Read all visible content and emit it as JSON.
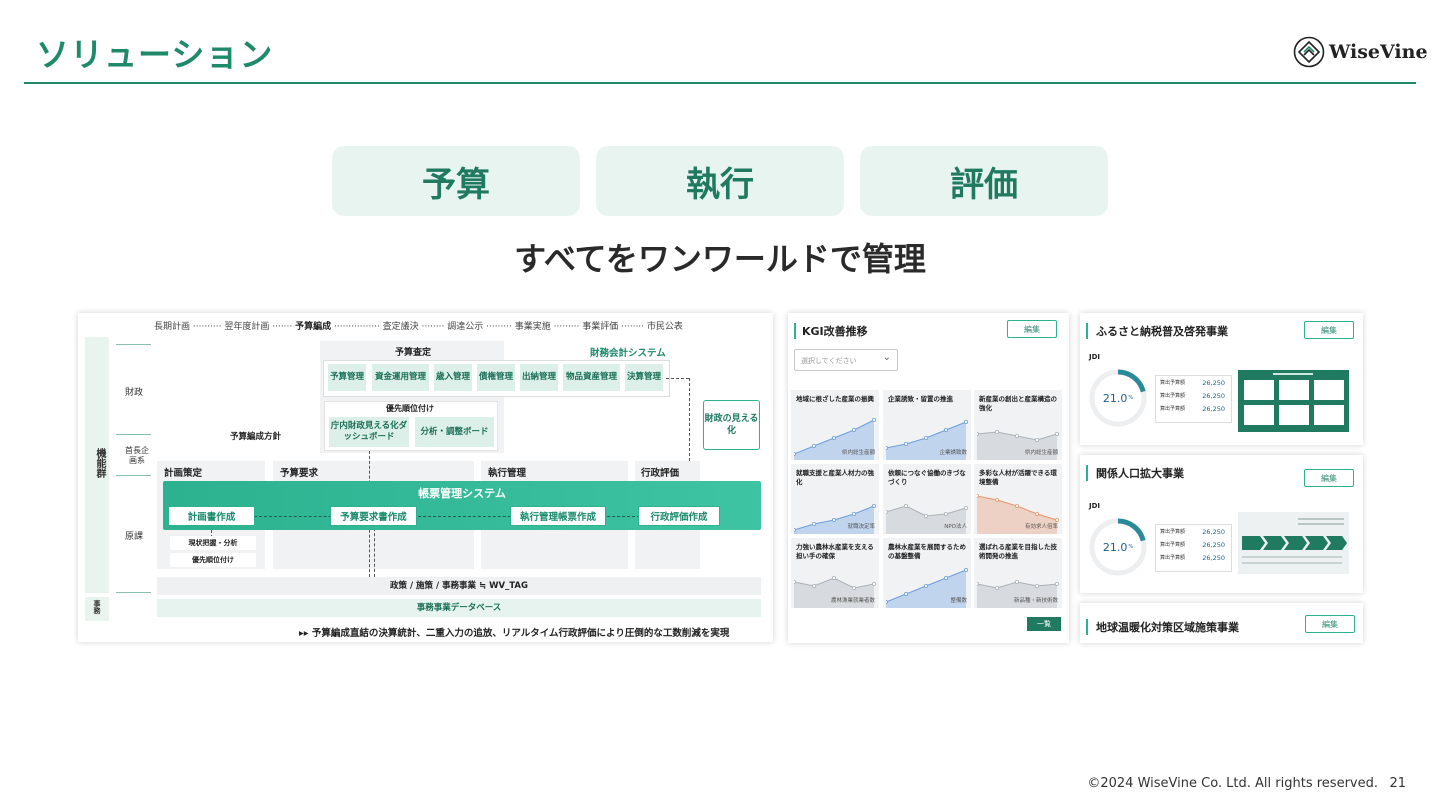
{
  "header": {
    "title": "ソリューション",
    "logo_text": "WiseVine"
  },
  "pills": [
    "予算",
    "執行",
    "評価"
  ],
  "subtitle": "すべてをワンワールドで管理",
  "diagram": {
    "timeline": [
      "長期計画",
      "翌年度計画",
      "予算編成",
      "査定議決",
      "調達公示",
      "事業実施",
      "事業評価",
      "市民公表"
    ],
    "side_group": "機能群",
    "rows": [
      "財政",
      "首長企画系",
      "原課"
    ],
    "db_label": "事務",
    "yosan_satei": "予算査定",
    "zaimu_system": "財務会計システム",
    "modules": [
      "予算管理",
      "資金運用管理",
      "歳入管理",
      "債権管理",
      "出納管理",
      "物品資産管理",
      "決算管理"
    ],
    "priority_label": "優先順位付け",
    "dashboard": "庁内財政見える化ダッシュボード",
    "analysis_board": "分析・調整ボード",
    "policy": "予算編成方針",
    "fin_visual": "財政の見える化",
    "columns": [
      "計画策定",
      "予算要求",
      "執行管理",
      "行政評価"
    ],
    "system_bar": "帳票管理システム",
    "system_buttons": [
      "計画書作成",
      "予算要求書作成",
      "執行管理帳票作成",
      "行政評価作成"
    ],
    "sub_items": [
      "現状把握・分析",
      "優先順位付け"
    ],
    "policy_row": "政策 / 施策 / 事務事業 ≒ WV_TAG",
    "db_row": "事務事業データベース",
    "caption": "▸▸ 予算編成直結の決算統計、二重入力の追放、リアルタイム行政評価により圧倒的な工数削減を実現"
  },
  "kgi": {
    "title": "KGI改善推移",
    "edit": "編集",
    "select_placeholder": "選択してください",
    "list_button": "一覧",
    "cards": [
      {
        "title": "地域に根ざした産業の振興",
        "footer": "県内総生産額"
      },
      {
        "title": "企業誘致・留置の推進",
        "footer": "企業誘致数"
      },
      {
        "title": "新産業の創出と産業構造の強化",
        "footer": "県内総生産額"
      },
      {
        "title": "就職支援と産業人材力の強化",
        "footer": "就職決定率"
      },
      {
        "title": "依頼につなぐ協働のきづなづくり",
        "footer": "NPO法人"
      },
      {
        "title": "多彩な人材が活躍できる環境整備",
        "footer": "有効求人倍率"
      },
      {
        "title": "力強い農林水産業を支える担い手の確保",
        "footer": "農林漁業就業者数"
      },
      {
        "title": "農林水産業を展開するための基盤整備",
        "footer": "整備数"
      },
      {
        "title": "選ばれる産業を目指した技術開発の推進",
        "footer": "新品種・新技術数"
      }
    ]
  },
  "projects": [
    {
      "title": "ふるさと納税普及啓発事業",
      "edit": "編集",
      "jdi": "JDI",
      "ring_value": "21.0",
      "ring_unit": "%",
      "rows": [
        {
          "label": "算出予算額",
          "value": "26,250"
        },
        {
          "label": "算出予算額",
          "value": "26,250"
        },
        {
          "label": "算出予算額",
          "value": "26,250"
        }
      ]
    },
    {
      "title": "関係人口拡大事業",
      "edit": "編集",
      "jdi": "JDI",
      "ring_value": "21.0",
      "ring_unit": "%",
      "rows": [
        {
          "label": "算出予算額",
          "value": "26,250"
        },
        {
          "label": "算出予算額",
          "value": "26,250"
        },
        {
          "label": "算出予算額",
          "value": "26,250"
        }
      ]
    },
    {
      "title": "地球温暖化対策区域施策事業",
      "edit": "編集"
    }
  ],
  "footer": {
    "copyright": "©2024 WiseVine Co. Ltd. All rights reserved.",
    "page": "21"
  },
  "colors": {
    "accent": "#1f8a6a",
    "bar": "#2cb28f",
    "pill_bg": "#e8f4ef"
  }
}
